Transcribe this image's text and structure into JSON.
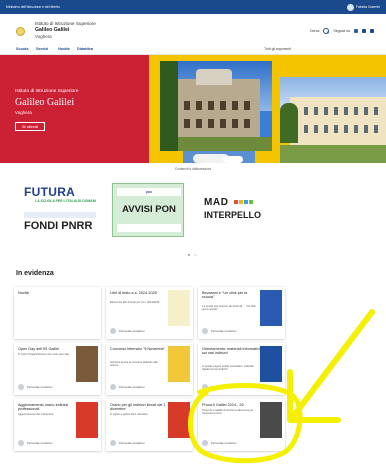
{
  "topbar": {
    "left_text": "Ministero dell'Istruzione e del Merito",
    "user_label": "Fabiola Guerrini"
  },
  "header": {
    "school_sup": "Istituto di Istruzione Superiore",
    "school_name": "Galileo Galilei",
    "school_city": "Voghera",
    "search_label": "Cerca",
    "follow_label": "Seguici su"
  },
  "nav": {
    "items": [
      "Scuola",
      "Servizi",
      "Novità",
      "Didattica"
    ],
    "right_label": "Tutti gli argomenti"
  },
  "hero": {
    "sup": "Istituto di Istruzione Superiore",
    "title": "Galileo Galilei",
    "city": "Voghera",
    "button_label": "Gli allievati"
  },
  "banners": {
    "label": "Contenuti e dirittureazioni",
    "futura": {
      "line1": "FUTURA",
      "line2": "LA SCUOLA PER L'ITALIA DI DOMANI",
      "line3": "FONDI PNRR"
    },
    "pon": {
      "strip": "pon",
      "text": "AVVISI PON"
    },
    "mad": {
      "line1": "MAD",
      "line2": "INTERPELLO"
    },
    "dots": "● ○"
  },
  "evidenza": {
    "title": "In evidenza",
    "author_label": "Personale scolastico",
    "cards": [
      {
        "title": "Novità",
        "desc": ""
      },
      {
        "title": "Libri di testo a.s. 2024-2025",
        "desc": "Elenco dei libri di testo per l'a.s. 2024/2025"
      },
      {
        "title": "Bevaanni e \"Un click per la scuola\"",
        "desc": "La scuola può ricevere dei fondi da ... \"Un click per la scuola\""
      },
      {
        "title": "Open Day dell'IIS Galilei",
        "desc": "Ti invito l'Organizzazione dei nostri open day"
      },
      {
        "title": "Concorso letterario \"Il Novembe\"",
        "desc": "Iscrizioni aperte al concorso dedicato alla ricerca..."
      },
      {
        "title": "Orientamento: materiali informativi sui vari indirizzi",
        "desc": "In queste pagine potete consultare i materiali digitali sui vari indirizzi"
      },
      {
        "title": "Aggiornamento orario indirizzi professionali",
        "desc": "Aggiornamento dal 1 dicembre"
      },
      {
        "title": "Orario per gli indirizzi liceali dal 1 dicembre",
        "desc": "In vigore a partire dal 1 dicembre"
      },
      {
        "title": "Prova Il Galilei 2024 - 26",
        "desc": "Scopri le modalità di iscrizione alla prova per l'accesso ai corsi"
      }
    ]
  },
  "colors": {
    "brand_blue": "#1a4a8c",
    "hero_red": "#cc2034",
    "hero_yellow": "#f5c400",
    "annotation_yellow": "#f4f000"
  }
}
